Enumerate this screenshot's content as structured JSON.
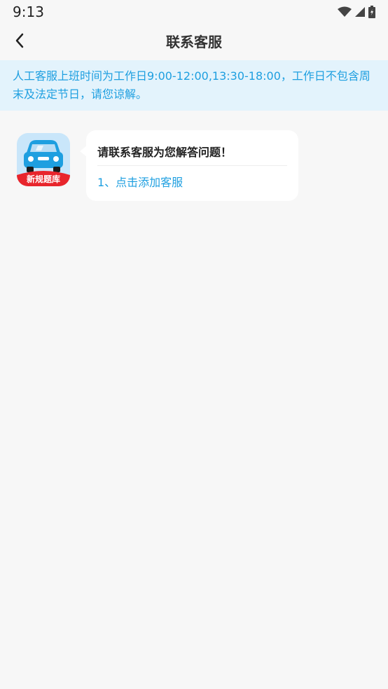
{
  "status_bar": {
    "time": "9:13",
    "icons": [
      "wifi-icon",
      "cellular-signal-icon",
      "battery-icon"
    ]
  },
  "header": {
    "title": "联系客服",
    "back_icon": "chevron-left-icon"
  },
  "notice": {
    "text": "人工客服上班时间为工作日9:00-12:00,13:30-18:00，工作日不包含周末及法定节日，请您谅解。"
  },
  "chat": {
    "avatar": {
      "badge_text": "新规题库",
      "colors": {
        "bg": "#c9e6fa",
        "car": "#1e9fe0",
        "ribbon": "#e8252c"
      }
    },
    "message": {
      "title": "请联系客服为您解答问题！",
      "link": "1、点击添加客服"
    }
  },
  "colors": {
    "accent": "#1e9fe0",
    "notice_bg": "#e3f3fc",
    "page_bg": "#f7f7f7"
  }
}
